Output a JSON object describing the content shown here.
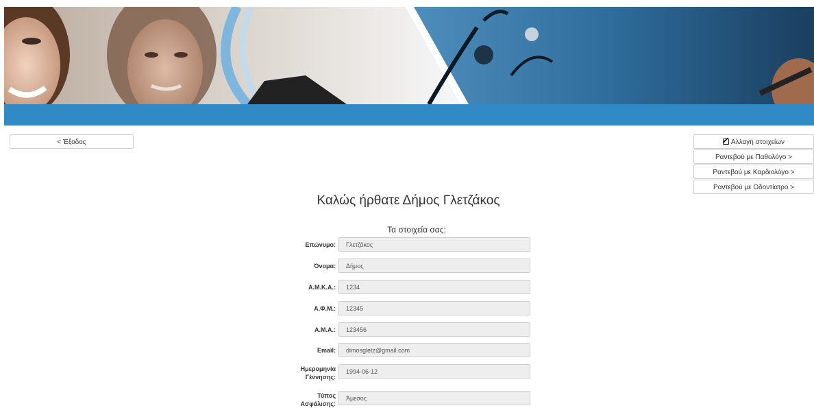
{
  "banner": {
    "accent": "#3189c6"
  },
  "nav": {
    "exit_label": "< Έξοδος"
  },
  "side_menu": {
    "edit_label": "Αλλαγή στοιχείων",
    "pathologist_label": "Ραντεβού με Παθολόγο >",
    "cardiologist_label": "Ραντεβού με Καρδιολόγο >",
    "dentist_label": "Ραντεβού με Οδοντίατρο >"
  },
  "main": {
    "welcome": "Καλώς ήρθατε Δήμος Γλετζάκος",
    "subtitle": "Τα στοιχεία σας:"
  },
  "profile": {
    "surname": {
      "label": "Επώνυμο:",
      "value": "Γλετζάκος"
    },
    "name": {
      "label": "Όνομα:",
      "value": "Δήμος"
    },
    "amka": {
      "label": "Α.Μ.Κ.Α.:",
      "value": "1234"
    },
    "afm": {
      "label": "Α.Φ.Μ.:",
      "value": "12345"
    },
    "ama": {
      "label": "Α.Μ.Α.:",
      "value": "123456"
    },
    "email": {
      "label": "Email:",
      "value": "dimosgletz@gmail.com"
    },
    "birthdate": {
      "label_line1": "Ημερομηνία",
      "label_line2": "Γέννησης:",
      "value": "1994-06-12"
    },
    "insurance": {
      "label_line1": "Τύπος",
      "label_line2": "Ασφάλισης:",
      "value": "Άμεσος"
    }
  }
}
